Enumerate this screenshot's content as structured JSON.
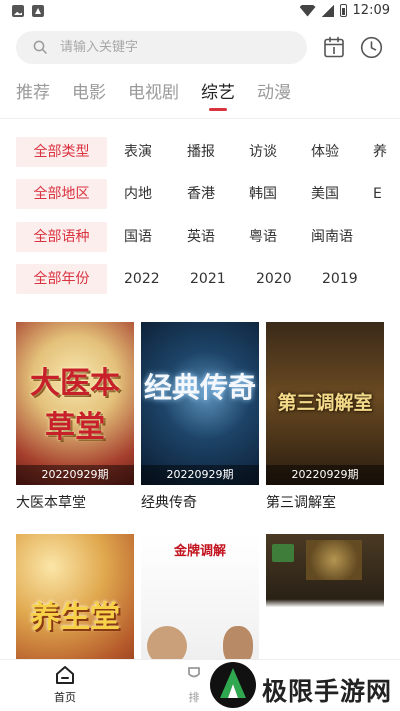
{
  "status_bar": {
    "time": "12:09"
  },
  "search": {
    "placeholder": "请输入关键字"
  },
  "tabs": [
    {
      "label": "推荐"
    },
    {
      "label": "电影"
    },
    {
      "label": "电视剧"
    },
    {
      "label": "综艺",
      "active": true
    },
    {
      "label": "动漫"
    }
  ],
  "filters": [
    {
      "label": "全部类型",
      "options": [
        "表演",
        "播报",
        "访谈",
        "体验",
        "养"
      ]
    },
    {
      "label": "全部地区",
      "options": [
        "内地",
        "香港",
        "韩国",
        "美国",
        "E"
      ]
    },
    {
      "label": "全部语种",
      "options": [
        "国语",
        "英语",
        "粤语",
        "闽南语"
      ]
    },
    {
      "label": "全部年份",
      "options": [
        "2022",
        "2021",
        "2020",
        "2019"
      ]
    }
  ],
  "shows": [
    {
      "title": "大医本草堂",
      "episode": "20220929期",
      "poster_text": "大医本草堂"
    },
    {
      "title": "经典传奇",
      "episode": "20220929期",
      "poster_text": "经典传奇"
    },
    {
      "title": "第三调解室",
      "episode": "20220929期",
      "poster_text": "第三调解室"
    },
    {
      "title": "",
      "episode": "",
      "poster_text": "养生堂"
    },
    {
      "title": "",
      "episode": "",
      "poster_text": "金牌调解"
    },
    {
      "title": "",
      "episode": "",
      "poster_text": ""
    }
  ],
  "bottom_nav": [
    {
      "label": "首页",
      "active": true
    },
    {
      "label": "排"
    }
  ],
  "watermark": {
    "text": "极限手游网"
  },
  "colors": {
    "accent": "#d9333f",
    "chip_bg": "#fdeeee"
  }
}
